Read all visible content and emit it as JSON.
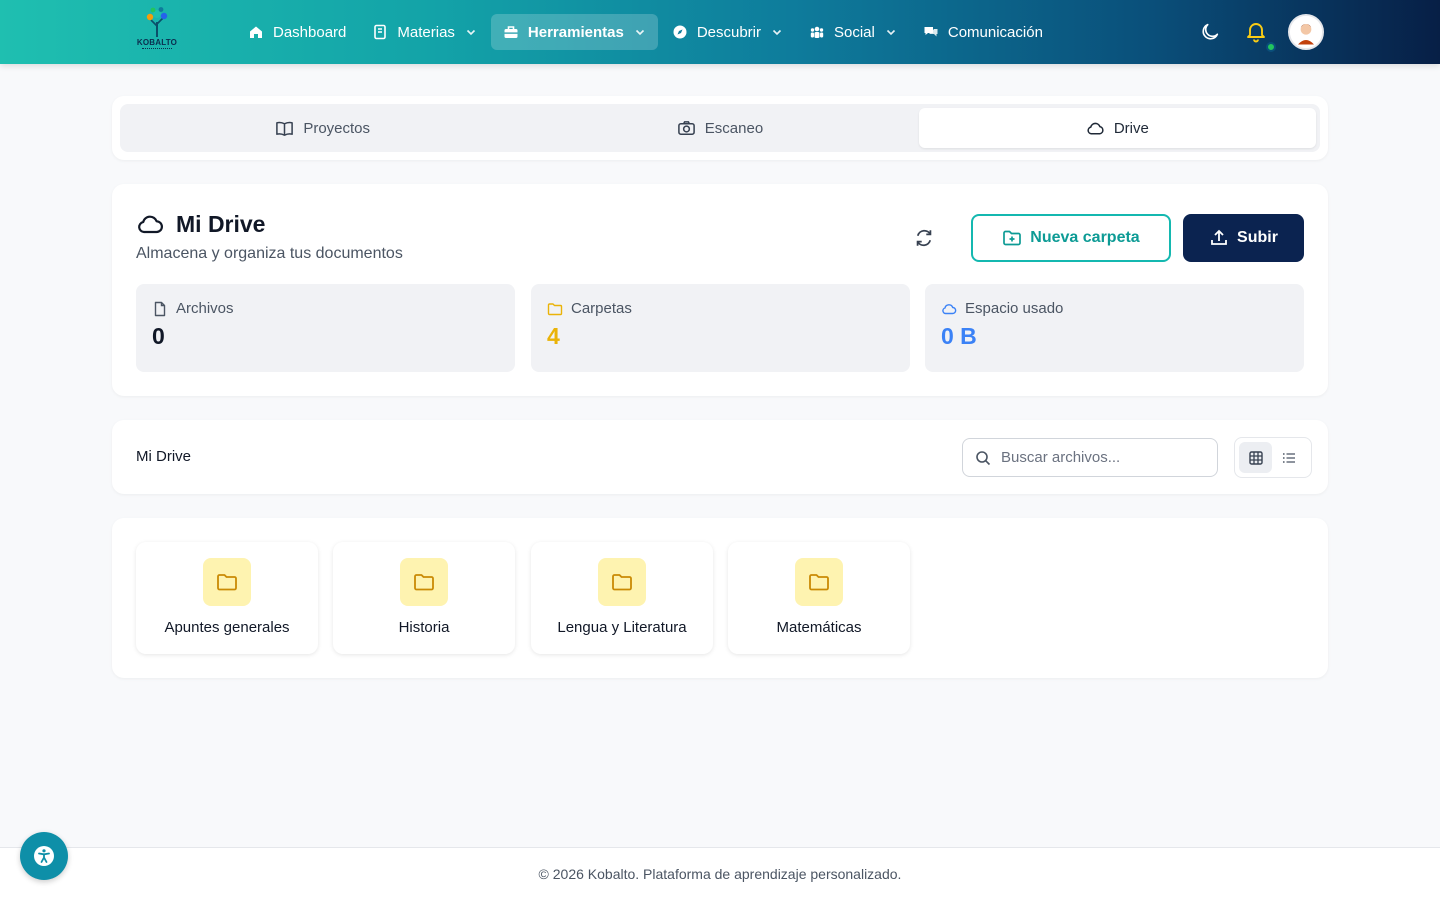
{
  "brand": {
    "logo_text": "KOBALTO"
  },
  "nav": {
    "items": [
      {
        "label": "Dashboard",
        "icon": "home-icon"
      },
      {
        "label": "Materias",
        "icon": "book-icon",
        "dropdown": true
      },
      {
        "label": "Herramientas",
        "icon": "toolbox-icon",
        "dropdown": true,
        "active": true
      },
      {
        "label": "Descubrir",
        "icon": "compass-icon",
        "dropdown": true
      },
      {
        "label": "Social",
        "icon": "users-icon",
        "dropdown": true
      },
      {
        "label": "Comunicación",
        "icon": "chat-icon"
      }
    ]
  },
  "tabs": [
    {
      "label": "Proyectos",
      "icon": "open-book-icon"
    },
    {
      "label": "Escaneo",
      "icon": "camera-icon"
    },
    {
      "label": "Drive",
      "icon": "cloud-icon",
      "active": true
    }
  ],
  "drive": {
    "title": "Mi Drive",
    "subtitle": "Almacena y organiza tus documentos",
    "new_folder_label": "Nueva carpeta",
    "upload_label": "Subir"
  },
  "stats": [
    {
      "label": "Archivos",
      "value": "0",
      "color": "#111827",
      "icon": "file-icon"
    },
    {
      "label": "Carpetas",
      "value": "4",
      "color": "#eab308",
      "icon": "folder-icon"
    },
    {
      "label": "Espacio usado",
      "value": "0 B",
      "color": "#3b82f6",
      "icon": "cloud-icon"
    }
  ],
  "toolbar": {
    "breadcrumb": "Mi Drive",
    "search_placeholder": "Buscar archivos..."
  },
  "folders": [
    {
      "name": "Apuntes generales"
    },
    {
      "name": "Historia"
    },
    {
      "name": "Lengua y Literatura"
    },
    {
      "name": "Matemáticas"
    }
  ],
  "footer": {
    "text": "© 2026 Kobalto. Plataforma de aprendizaje personalizado."
  },
  "colors": {
    "accent_teal": "#14b8b0",
    "primary_navy": "#0b2350",
    "folder_yellow": "#eab308",
    "notification_bell": "#facc15",
    "online_dot": "#22c55e"
  }
}
